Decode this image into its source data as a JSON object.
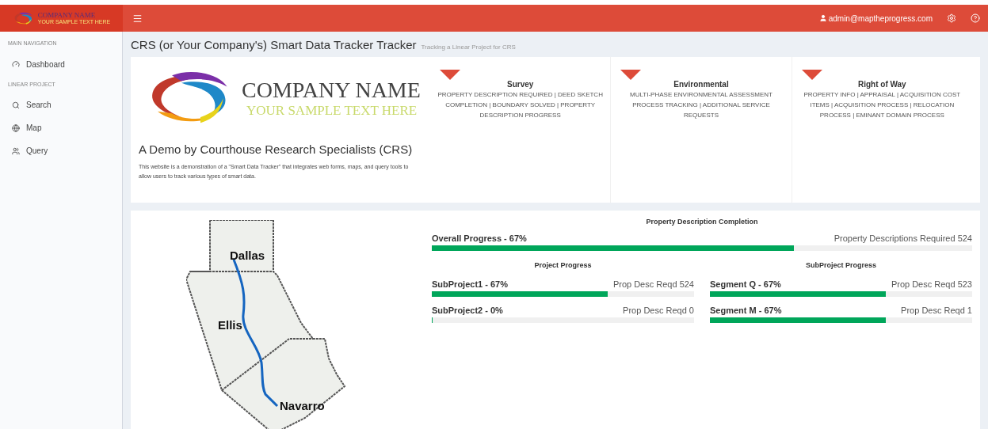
{
  "header": {
    "logo_name": "COMPANY NAME",
    "logo_tagline": "YOUR SAMPLE TEXT HERE",
    "user": "admin@maptheprogress.com"
  },
  "sidebar": {
    "sections": [
      {
        "title": "MAIN NAVIGATION",
        "items": [
          {
            "label": "Dashboard",
            "kind": "dashboard"
          }
        ]
      },
      {
        "title": "LINEAR PROJECT",
        "items": [
          {
            "label": "Search",
            "kind": "search"
          },
          {
            "label": "Map",
            "kind": "map"
          },
          {
            "label": "Query",
            "kind": "query"
          }
        ]
      }
    ]
  },
  "page": {
    "title": "CRS (or Your Company's) Smart Data Tracker Tracker",
    "subtitle": "Tracking a Linear Project for CRS"
  },
  "intro": {
    "logo_name": "COMPANY NAME",
    "logo_tagline": "YOUR SAMPLE TEXT HERE",
    "heading": "A Demo by Courthouse Research Specialists (CRS)",
    "text": "This website is a demonstration of a \"Smart Data Tracker\" that integrates web forms, maps, and query tools to allow users to track various types of smart data."
  },
  "categories": [
    {
      "title": "Survey",
      "text": "PROPERTY DESCRIPTION REQUIRED | DEED SKETCH COMPLETION | BOUNDARY SOLVED | PROPERTY DESCRIPTION PROGRESS"
    },
    {
      "title": "Environmental",
      "text": "MULTI-PHASE ENVIRONMENTAL ASSESSMENT PROCESS TRACKING | ADDITIONAL SERVICE REQUESTS"
    },
    {
      "title": "Right of Way",
      "text": "PROPERTY INFO | APPRAISAL | ACQUISITION COST ITEMS | ACQUISITION PROCESS | RELOCATION PROCESS | EMINANT DOMAIN PROCESS"
    }
  ],
  "map": {
    "counties": [
      "Dallas",
      "Ellis",
      "Navarro"
    ]
  },
  "progress": {
    "title": "Property Description Completion",
    "overall": {
      "label": "Overall Progress - 67%",
      "reading": "Property Descriptions Required 524",
      "level": 0.67
    },
    "groups": [
      {
        "title": "Project Progress",
        "bars": [
          {
            "label": "SubProject1 - 67%",
            "reading": "Prop Desc Reqd 524",
            "level": 0.67
          },
          {
            "label": "SubProject2 - 0%",
            "reading": "Prop Desc Reqd 0",
            "level": 0
          }
        ]
      },
      {
        "title": "SubProject Progress",
        "bars": [
          {
            "label": "Segment Q - 67%",
            "reading": "Prop Desc Reqd 523",
            "level": 0.67
          },
          {
            "label": "Segment M - 67%",
            "reading": "Prop Desc Reqd 1",
            "level": 0.67
          }
        ]
      }
    ]
  }
}
